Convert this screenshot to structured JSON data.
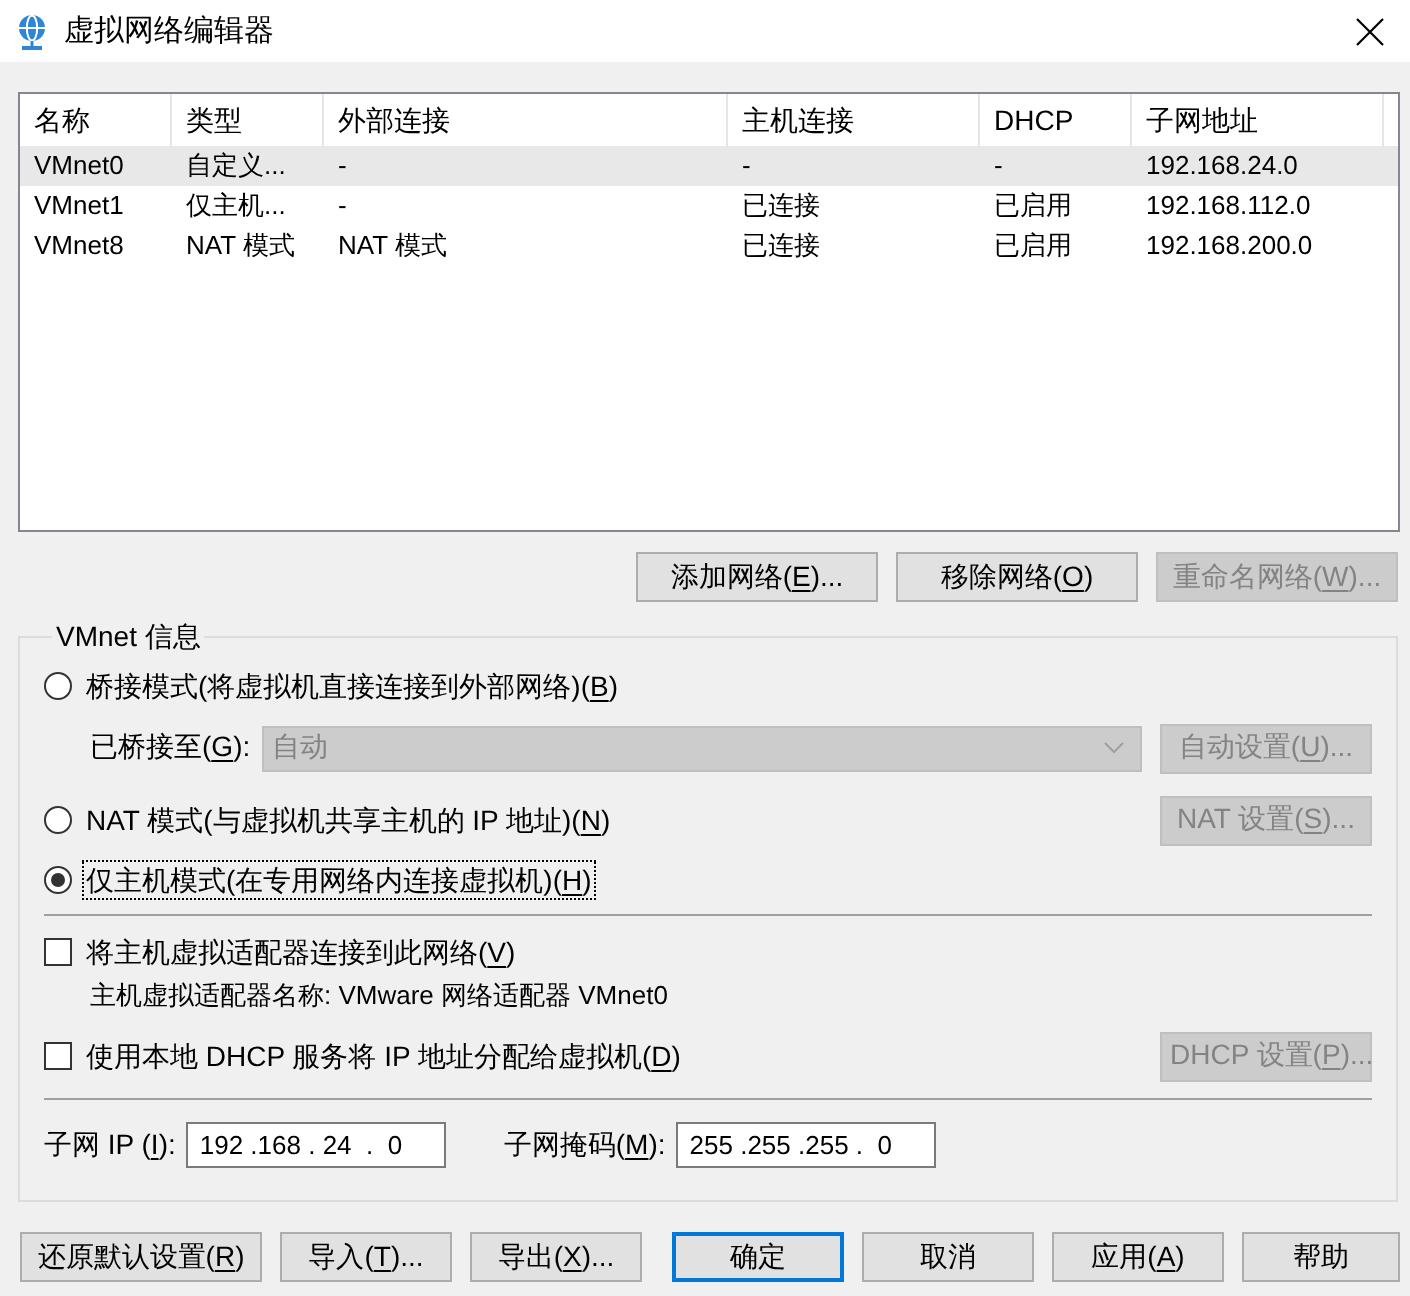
{
  "window": {
    "title": "虚拟网络编辑器"
  },
  "table": {
    "columns": [
      "名称",
      "类型",
      "外部连接",
      "主机连接",
      "DHCP",
      "子网地址"
    ],
    "rows": [
      {
        "cells": [
          "VMnet0",
          "自定义...",
          "-",
          "-",
          "-",
          "192.168.24.0"
        ],
        "selected": true
      },
      {
        "cells": [
          "VMnet1",
          "仅主机...",
          "-",
          "已连接",
          "已启用",
          "192.168.112.0"
        ],
        "selected": false
      },
      {
        "cells": [
          "VMnet8",
          "NAT 模式",
          "NAT 模式",
          "已连接",
          "已启用",
          "192.168.200.0"
        ],
        "selected": false
      }
    ]
  },
  "network_buttons": [
    {
      "label": {
        "before": "添加网络(",
        "access_key": "E",
        "after": ")..."
      },
      "disabled": false
    },
    {
      "label": {
        "before": "移除网络(",
        "access_key": "O",
        "after": ")"
      },
      "disabled": false
    },
    {
      "label": {
        "before": "重命名网络(",
        "access_key": "W",
        "after": ")..."
      },
      "disabled": true
    }
  ],
  "vmnet_info": {
    "legend": "VMnet 信息",
    "modes": [
      {
        "label": {
          "before": "桥接模式(将虚拟机直接连接到外部网络)(",
          "access_key": "B",
          "after": ")"
        },
        "selected": false,
        "focused": false,
        "bridge_to": {
          "label": {
            "before": "已桥接至(",
            "access_key": "G",
            "after": "):"
          },
          "value": "自动",
          "disabled": true,
          "button": {
            "label": {
              "before": "自动设置(",
              "access_key": "U",
              "after": ")..."
            },
            "disabled": true
          }
        }
      },
      {
        "label": {
          "before": "NAT 模式(与虚拟机共享主机的 IP 地址)(",
          "access_key": "N",
          "after": ")"
        },
        "selected": false,
        "focused": false,
        "button": {
          "label": {
            "before": "NAT 设置(",
            "access_key": "S",
            "after": ")..."
          },
          "disabled": true
        }
      },
      {
        "label": {
          "before": "仅主机模式(在专用网络内连接虚拟机)(",
          "access_key": "H",
          "after": ")"
        },
        "selected": true,
        "focused": true
      }
    ],
    "options": [
      {
        "label": {
          "before": "将主机虚拟适配器连接到此网络(",
          "access_key": "V",
          "after": ")"
        },
        "checked": false,
        "note": "主机虚拟适配器名称: VMware 网络适配器 VMnet0"
      },
      {
        "label": {
          "before": "使用本地 DHCP 服务将 IP 地址分配给虚拟机(",
          "access_key": "D",
          "after": ")"
        },
        "checked": false,
        "button": {
          "label": {
            "before": "DHCP 设置(",
            "access_key": "P",
            "after": ")..."
          },
          "disabled": true
        }
      }
    ],
    "subnet_ip": {
      "label": {
        "before": "子网 IP (",
        "access_key": "I",
        "after": "):"
      },
      "value": "192 .168 . 24  .  0"
    },
    "subnet_mask": {
      "label": {
        "before": "子网掩码(",
        "access_key": "M",
        "after": "):"
      },
      "value": "255 .255 .255 .  0"
    }
  },
  "dialog_buttons": [
    {
      "label": {
        "before": "还原默认设置(",
        "access_key": "R",
        "after": ")"
      },
      "default": false
    },
    {
      "label": {
        "before": "导入(",
        "access_key": "T",
        "after": ")..."
      },
      "default": false
    },
    {
      "label": {
        "before": "导出(",
        "access_key": "X",
        "after": ")..."
      },
      "default": false
    },
    {
      "label": {
        "before": "确定"
      },
      "default": true
    },
    {
      "label": {
        "before": "取消"
      },
      "default": false
    },
    {
      "label": {
        "before": "应用(",
        "access_key": "A",
        "after": ")"
      },
      "default": false
    },
    {
      "label": {
        "before": "帮助"
      },
      "default": false
    }
  ]
}
